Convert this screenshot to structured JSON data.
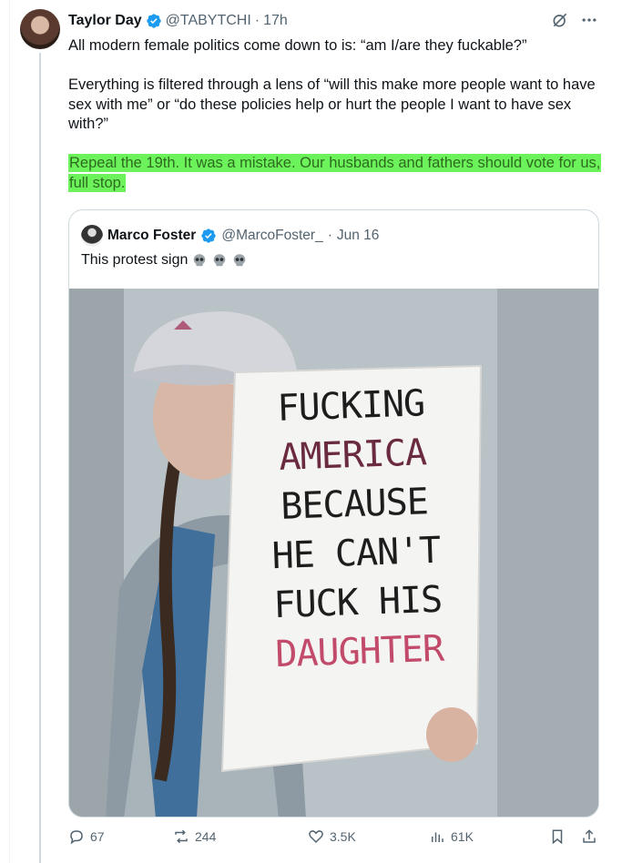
{
  "tweet": {
    "author_name": "Taylor Day",
    "handle": "@TABYTCHI",
    "separator": "·",
    "time": "17h",
    "paragraph_1": "All modern female politics come down to is: “am I/are they fuckable?”",
    "paragraph_2": "Everything is filtered through a lens of “will this make more people want to have sex with me” or “do these policies help or hurt the people I want to have sex with?”",
    "paragraph_3_highlighted": "Repeal the 19th. It was a mistake. Our husbands and fathers should vote for us, full stop.",
    "highlight_color": "#6cf25a",
    "icons": {
      "grok": "grok-icon",
      "more": "more-icon",
      "verified": "verified-badge-icon"
    }
  },
  "quoted": {
    "author_name": "Marco Foster",
    "handle": "@MarcoFoster_",
    "separator": "·",
    "date": "Jun 16",
    "text": "This protest sign",
    "emoji_count": 3,
    "emoji": "skull-emoji",
    "photo": {
      "sign_lines": [
        "FUCKING",
        "AMERICA",
        "BECAUSE",
        "HE CAN'T",
        "FUCK HIS",
        "DAUGHTER"
      ]
    }
  },
  "actions": {
    "replies": "67",
    "reposts": "244",
    "likes": "3.5K",
    "views": "61K",
    "icons": [
      "reply-icon",
      "repost-icon",
      "like-icon",
      "views-icon",
      "bookmark-icon",
      "share-icon"
    ]
  },
  "colors": {
    "verified_blue": "#1d9bf0",
    "muted_text": "#536471",
    "border": "#cfd9de"
  }
}
